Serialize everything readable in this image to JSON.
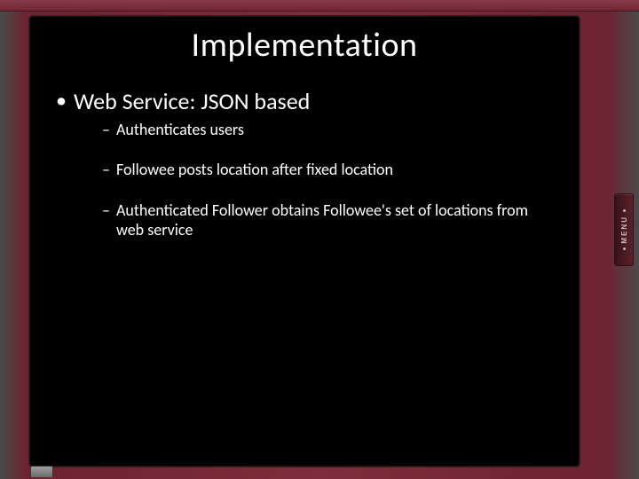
{
  "slide": {
    "title": "Implementation",
    "bullets": [
      {
        "text": "Web Service: JSON based",
        "children": [
          "Authenticates users",
          "Followee posts location after fixed location",
          "Authenticated Follower obtains Followee's set of locations from web service"
        ]
      }
    ]
  },
  "device": {
    "menu_label": "MENU"
  }
}
